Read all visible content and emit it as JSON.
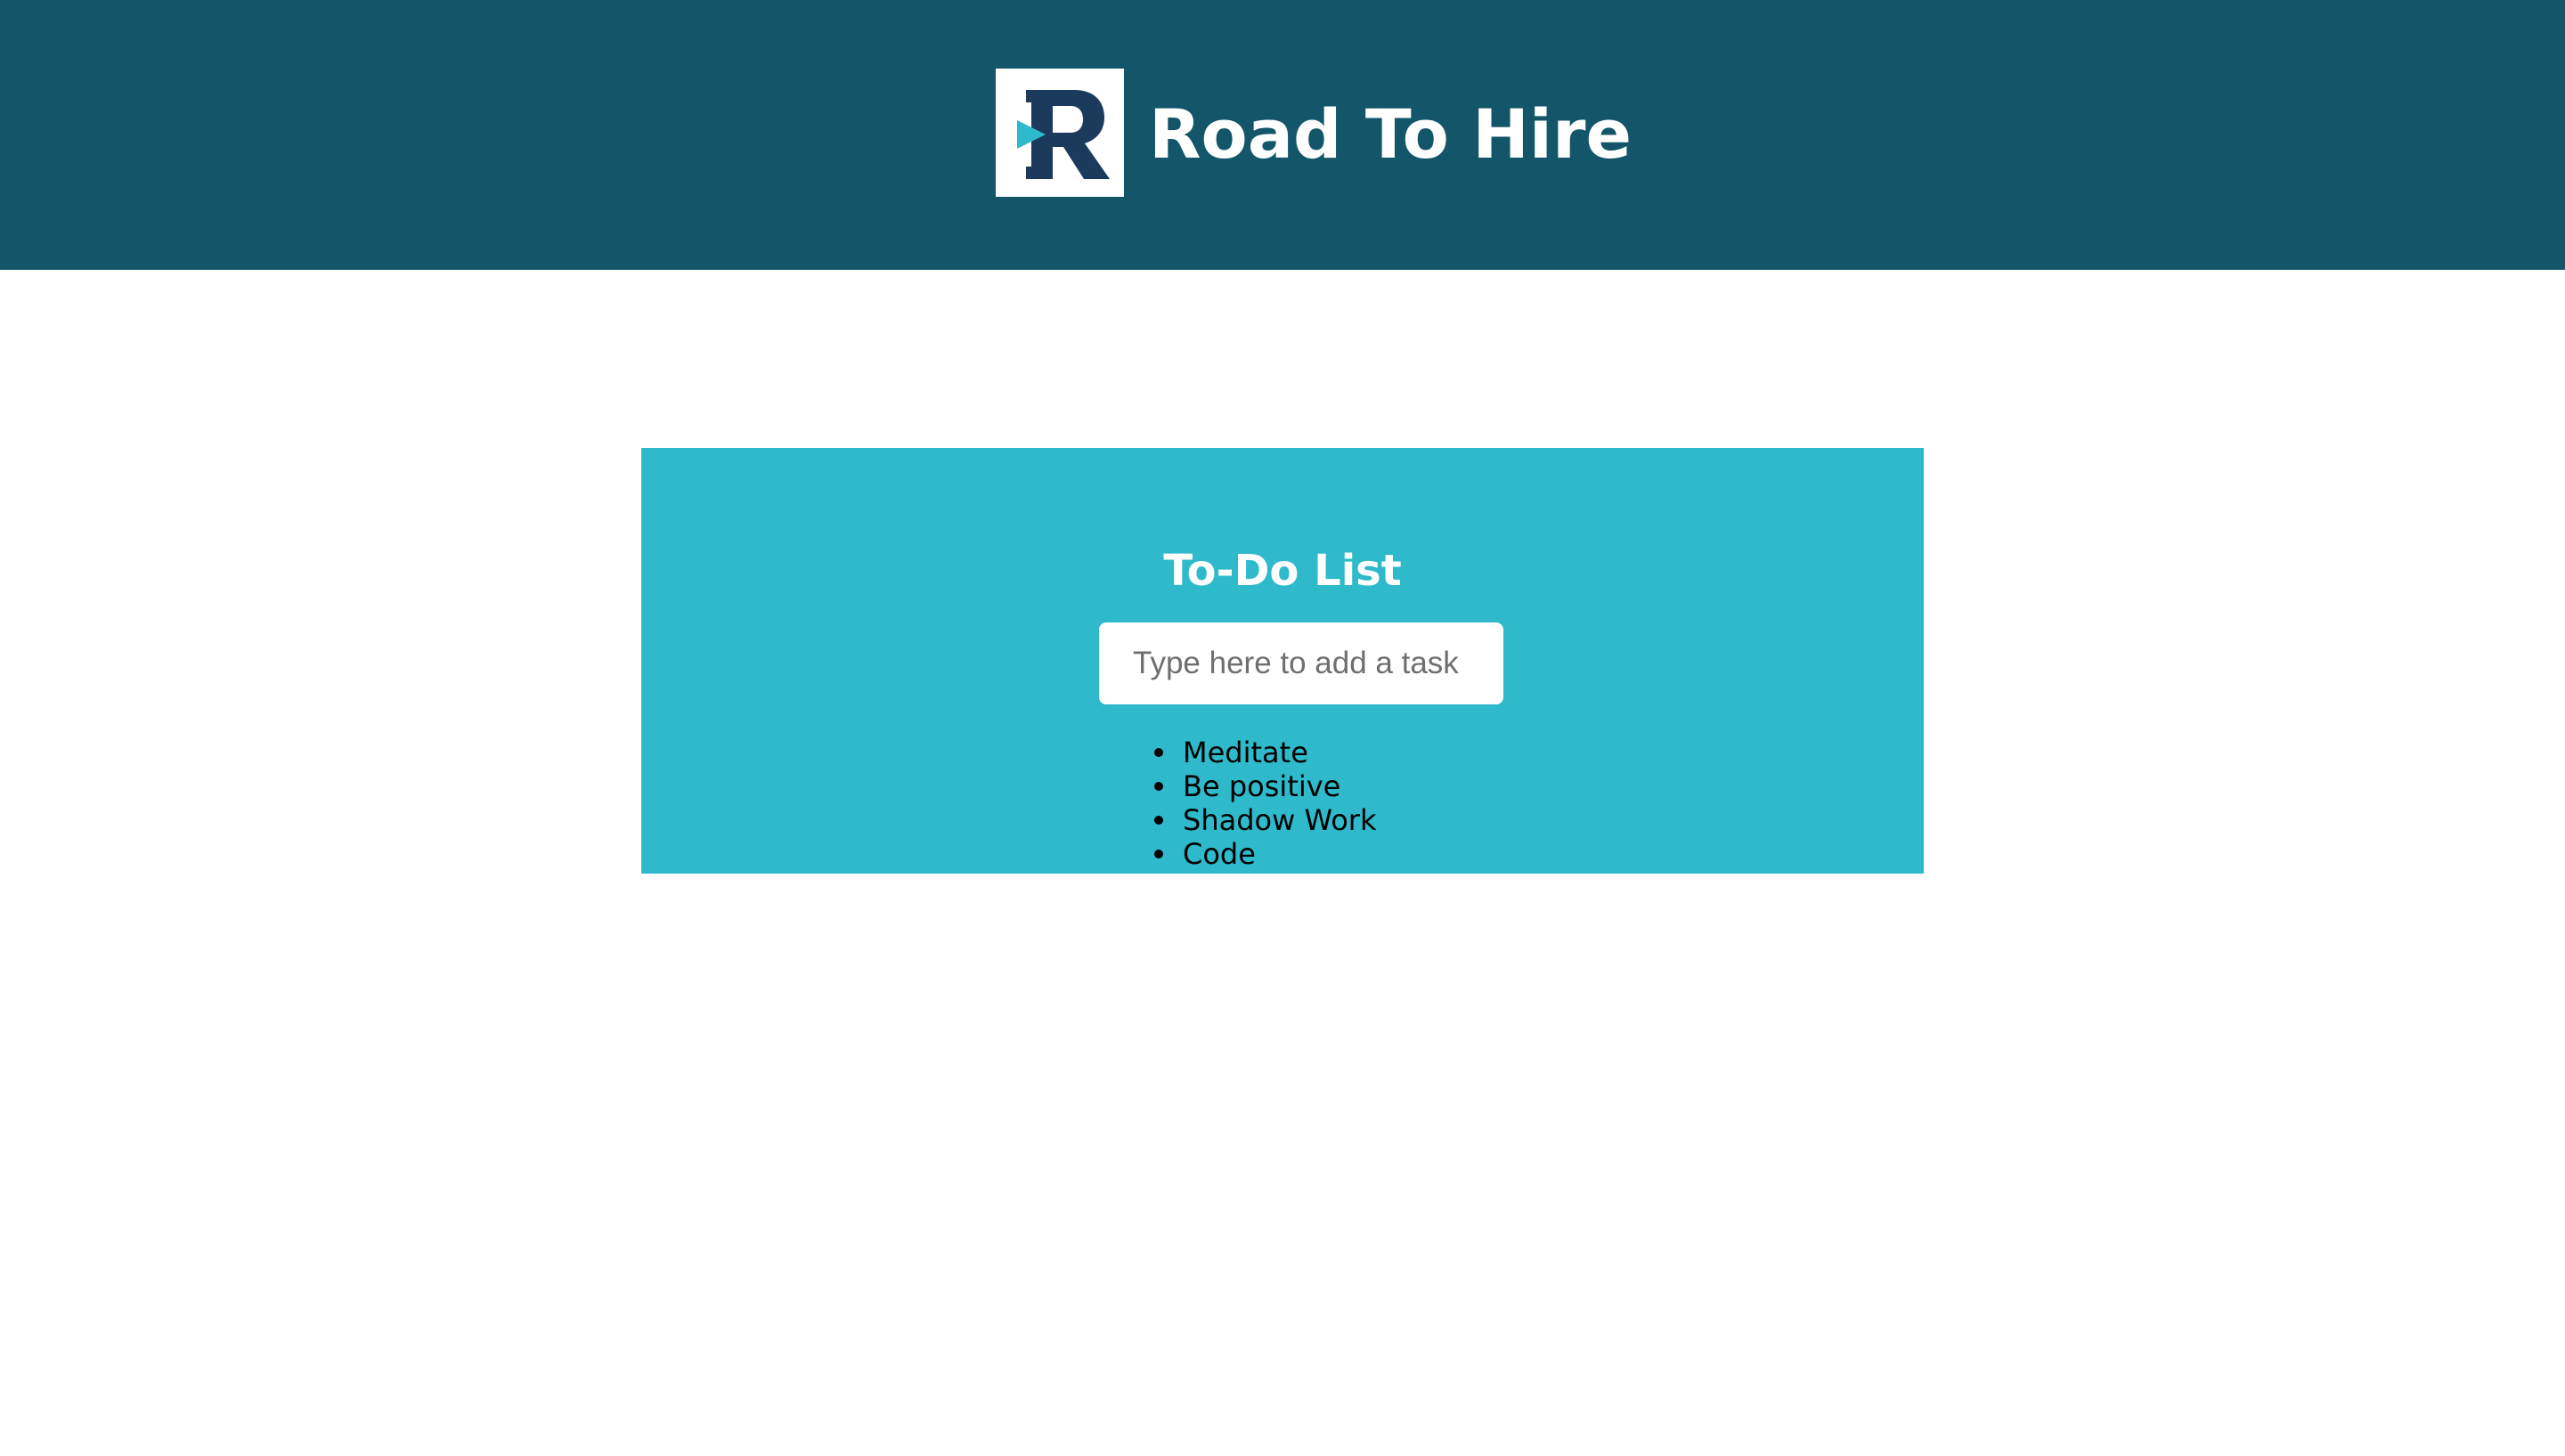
{
  "header": {
    "brand_name": "Road To Hire",
    "logo_icon": "road-to-hire-r-logo",
    "background_color": "#135569"
  },
  "todo": {
    "title": "To-Do List",
    "input_placeholder": "Type here to add a task",
    "input_value": "",
    "panel_color": "#2ebacb",
    "tasks": [
      {
        "label": "Meditate"
      },
      {
        "label": "Be positive"
      },
      {
        "label": "Shadow Work"
      },
      {
        "label": "Code"
      }
    ]
  }
}
